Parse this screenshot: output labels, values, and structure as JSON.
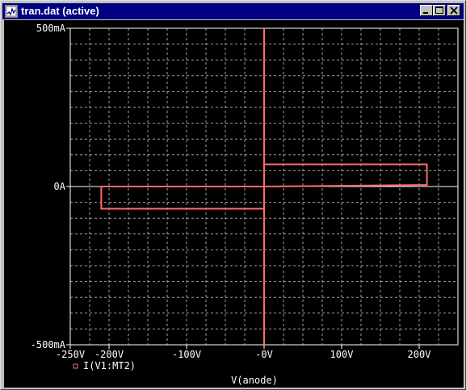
{
  "window": {
    "title": "tran.dat (active)",
    "minimize_icon": "minimize-icon",
    "maximize_icon": "maximize-icon",
    "close_icon": "close-icon",
    "app_icon": "probe-app-icon"
  },
  "colors": {
    "title_bar": "#000080",
    "plot_background": "#000000",
    "grid": "#c8c8c8",
    "trace": "#ff6b6b",
    "text": "#ffffff"
  },
  "chart_data": {
    "type": "line",
    "title": "",
    "xlabel": "V(anode)",
    "ylabel": "",
    "xlim": [
      -250,
      250
    ],
    "ylim": [
      -500,
      500
    ],
    "grid": true,
    "x_ticks": [
      "-250V",
      "-200V",
      "-100V",
      "-0V",
      "100V",
      "200V"
    ],
    "x_tick_values": [
      -250,
      -200,
      -100,
      0,
      100,
      200
    ],
    "y_ticks": [
      "500mA",
      "0A",
      "-500mA"
    ],
    "y_tick_values": [
      500,
      0,
      -500
    ],
    "legend_placement": "bottom-left",
    "series": [
      {
        "name": "I(V1:MT2)",
        "color": "#ff6b6b",
        "x": [
          0,
          0,
          0,
          210,
          210,
          0,
          -210,
          -210,
          0,
          0,
          0
        ],
        "y": [
          -500,
          0,
          70,
          70,
          5,
          0,
          0,
          -70,
          -70,
          0,
          500
        ]
      }
    ]
  }
}
